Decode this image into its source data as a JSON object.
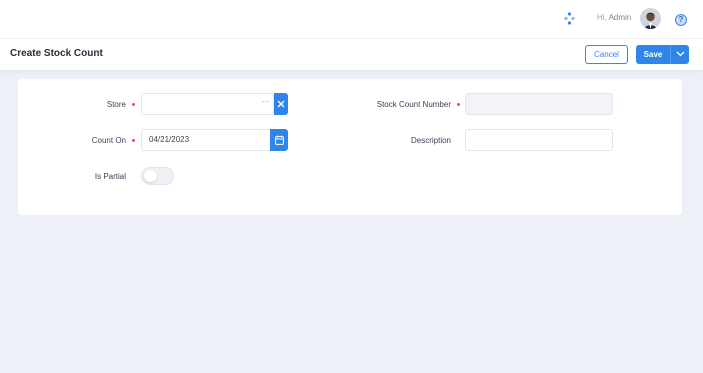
{
  "header": {
    "greeting_prefix": "Hi,",
    "user_name": "Admin",
    "help_label": "?",
    "icons": {
      "apps": "apps-icon",
      "avatar": "avatar",
      "help": "help-icon"
    }
  },
  "subheader": {
    "title": "Create Stock Count",
    "cancel_label": "Cancel",
    "save_label": "Save"
  },
  "form": {
    "store": {
      "label": "Store",
      "value": "",
      "required": true,
      "lookup_label": "···"
    },
    "count_on": {
      "label": "Count On",
      "value": "04/21/2023",
      "required": true
    },
    "is_partial": {
      "label": "Is Partial",
      "checked": false
    },
    "stock_count_number": {
      "label": "Stock Count Number",
      "value": "",
      "required": true,
      "disabled": true
    },
    "description": {
      "label": "Description",
      "value": ""
    }
  },
  "colors": {
    "primary": "#2f86e8",
    "required_dot": "#f1416c",
    "background": "#eef0f7"
  }
}
